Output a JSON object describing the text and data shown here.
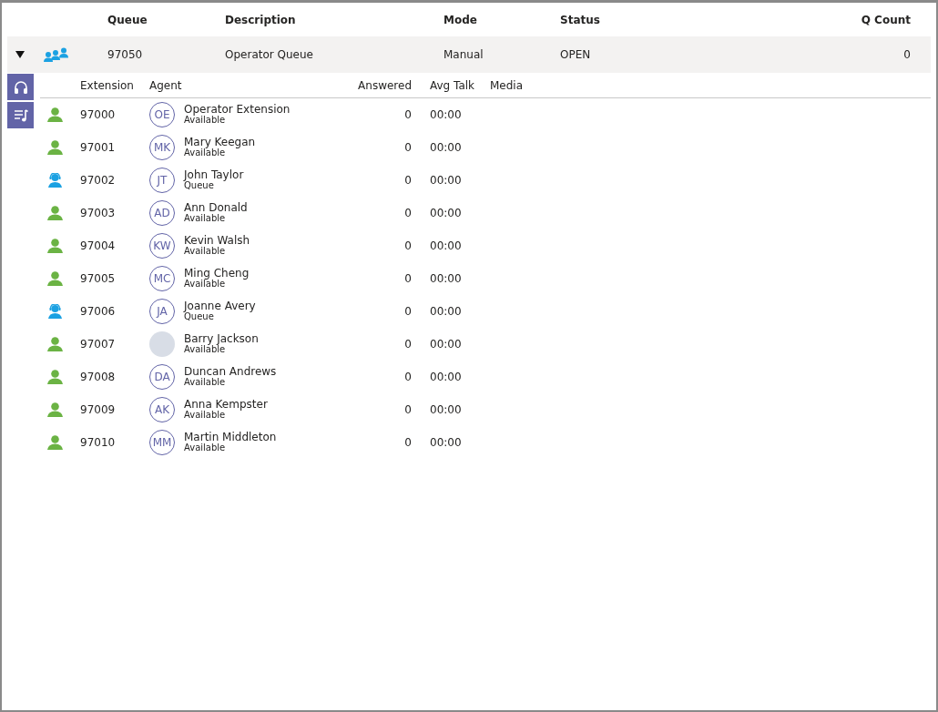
{
  "queue_table": {
    "columns": [
      "Queue",
      "Description",
      "Mode",
      "Status",
      "Q Count"
    ],
    "rows": [
      {
        "expanded": true,
        "queue": "97050",
        "description": "Operator Queue",
        "mode": "Manual",
        "status": "OPEN",
        "q_count": "0"
      }
    ]
  },
  "side_tabs": [
    {
      "kind": "agents"
    },
    {
      "kind": "playlist"
    }
  ],
  "agent_table": {
    "columns": [
      "Extension",
      "Agent",
      "Answered",
      "Avg Talk",
      "Media"
    ],
    "rows": [
      {
        "extension": "97000",
        "avatar": {
          "kind": "initials",
          "text": "OE"
        },
        "name": "Operator Extension",
        "state": "Available",
        "kind": "available",
        "answered": "0",
        "avg_talk": "00:00"
      },
      {
        "extension": "97001",
        "avatar": {
          "kind": "initials",
          "text": "MK"
        },
        "name": "Mary Keegan",
        "state": "Available",
        "kind": "available",
        "answered": "0",
        "avg_talk": "00:00"
      },
      {
        "extension": "97002",
        "avatar": {
          "kind": "initials",
          "text": "JT"
        },
        "name": "John Taylor",
        "state": "Queue",
        "kind": "queue",
        "answered": "0",
        "avg_talk": "00:00"
      },
      {
        "extension": "97003",
        "avatar": {
          "kind": "initials",
          "text": "AD"
        },
        "name": "Ann Donald",
        "state": "Available",
        "kind": "available",
        "answered": "0",
        "avg_talk": "00:00"
      },
      {
        "extension": "97004",
        "avatar": {
          "kind": "initials",
          "text": "KW"
        },
        "name": "Kevin Walsh",
        "state": "Available",
        "kind": "available",
        "answered": "0",
        "avg_talk": "00:00"
      },
      {
        "extension": "97005",
        "avatar": {
          "kind": "initials",
          "text": "MC"
        },
        "name": "Ming Cheng",
        "state": "Available",
        "kind": "available",
        "answered": "0",
        "avg_talk": "00:00"
      },
      {
        "extension": "97006",
        "avatar": {
          "kind": "initials",
          "text": "JA"
        },
        "name": "Joanne Avery",
        "state": "Queue",
        "kind": "queue",
        "answered": "0",
        "avg_talk": "00:00"
      },
      {
        "extension": "97007",
        "avatar": {
          "kind": "photo"
        },
        "name": "Barry Jackson",
        "state": "Available",
        "kind": "available",
        "answered": "0",
        "avg_talk": "00:00"
      },
      {
        "extension": "97008",
        "avatar": {
          "kind": "initials",
          "text": "DA"
        },
        "name": "Duncan Andrews",
        "state": "Available",
        "kind": "available",
        "answered": "0",
        "avg_talk": "00:00"
      },
      {
        "extension": "97009",
        "avatar": {
          "kind": "initials",
          "text": "AK"
        },
        "name": "Anna Kempster",
        "state": "Available",
        "kind": "available",
        "answered": "0",
        "avg_talk": "00:00"
      },
      {
        "extension": "97010",
        "avatar": {
          "kind": "initials",
          "text": "MM"
        },
        "name": "Martin Middleton",
        "state": "Available",
        "kind": "available",
        "answered": "0",
        "avg_talk": "00:00"
      }
    ]
  }
}
